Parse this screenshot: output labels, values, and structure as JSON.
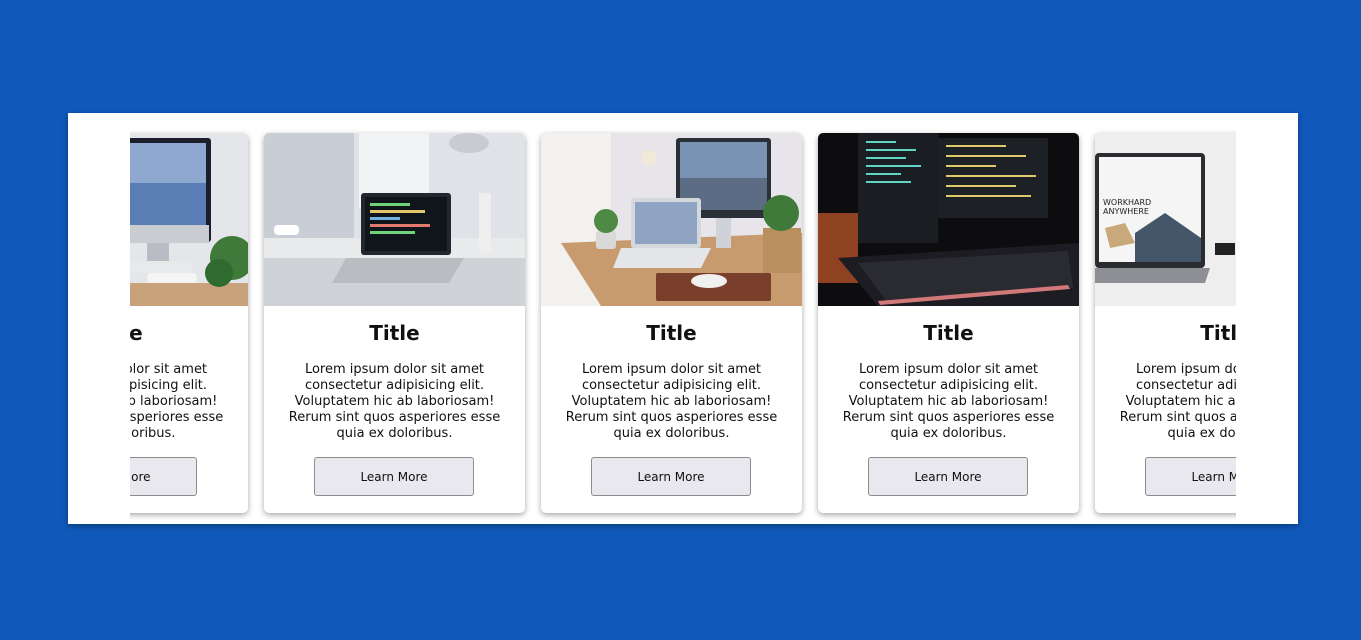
{
  "carousel": {
    "cards": [
      {
        "image_icon": "desk-imac-photo",
        "title": "Title",
        "text": "Lorem ipsum dolor sit amet consectetur adipisicing elit. Voluptatem hic ab laboriosam! Rerum sint quos asperiores esse quia ex doloribus.",
        "button_label": "Learn More"
      },
      {
        "image_icon": "laptop-code-desk-photo",
        "title": "Title",
        "text": "Lorem ipsum dolor sit amet consectetur adipisicing elit. Voluptatem hic ab laboriosam! Rerum sint quos asperiores esse quia ex doloribus.",
        "button_label": "Learn More"
      },
      {
        "image_icon": "wooden-desk-laptop-photo",
        "title": "Title",
        "text": "Lorem ipsum dolor sit amet consectetur adipisicing elit. Voluptatem hic ab laboriosam! Rerum sint quos asperiores esse quia ex doloribus.",
        "button_label": "Learn More"
      },
      {
        "image_icon": "dark-keyboard-code-photo",
        "title": "Title",
        "text": "Lorem ipsum dolor sit amet consectetur adipisicing elit. Voluptatem hic ab laboriosam! Rerum sint quos asperiores esse quia ex doloribus.",
        "button_label": "Learn More"
      },
      {
        "image_icon": "workhard-laptop-photo",
        "image_caption": "WORKHARD ANYWHERE",
        "title": "Title",
        "text": "Lorem ipsum dolor sit amet consectetur adipisicing elit. Voluptatem hic ab laboriosam! Rerum sint quos asperiores esse quia ex doloribus.",
        "button_label": "Learn More"
      }
    ]
  },
  "colors": {
    "page_background": "#1059bb",
    "panel_background": "#ffffff",
    "button_background": "#e9e8ee"
  }
}
